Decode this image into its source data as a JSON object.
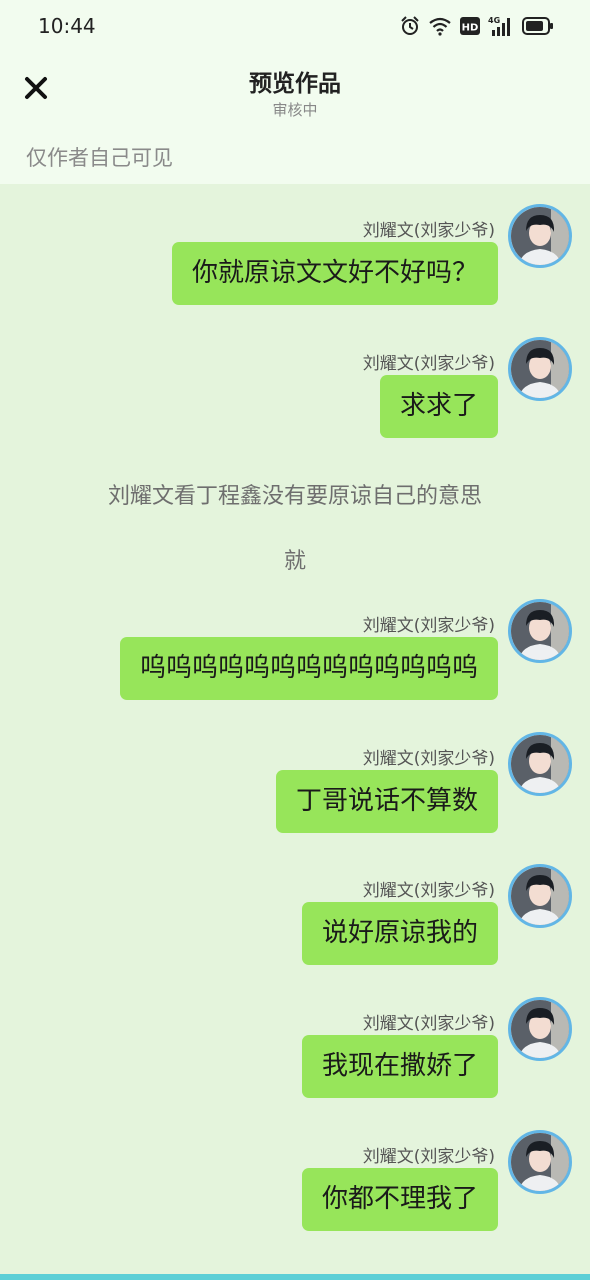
{
  "status_bar": {
    "time": "10:44",
    "icons": [
      "alarm-icon",
      "wifi-icon",
      "hd-icon",
      "signal-4g-icon",
      "battery-icon"
    ],
    "hd_label": "HD",
    "network_label": "4G"
  },
  "nav": {
    "close_icon": "close-icon",
    "title": "预览作品",
    "subtitle": "审核中"
  },
  "visibility_note": "仅作者自己可见",
  "colors": {
    "background": "#e4f4dc",
    "header_background": "#f2fcef",
    "bubble": "#97e55a",
    "avatar_border": "#62b6e6",
    "bottom_strip": "#5ccfd6"
  },
  "chat": [
    {
      "type": "message",
      "sender": "刘耀文(刘家少爷)",
      "text": "你就原谅文文好不好吗？"
    },
    {
      "type": "message",
      "sender": "刘耀文(刘家少爷)",
      "text": "求求了"
    },
    {
      "type": "narration",
      "text": "刘耀文看丁程鑫没有要原谅自己的意思"
    },
    {
      "type": "narration",
      "text": "就"
    },
    {
      "type": "message",
      "sender": "刘耀文(刘家少爷)",
      "text": "呜呜呜呜呜呜呜呜呜呜呜呜呜"
    },
    {
      "type": "message",
      "sender": "刘耀文(刘家少爷)",
      "text": "丁哥说话不算数"
    },
    {
      "type": "message",
      "sender": "刘耀文(刘家少爷)",
      "text": "说好原谅我的"
    },
    {
      "type": "message",
      "sender": "刘耀文(刘家少爷)",
      "text": "我现在撒娇了"
    },
    {
      "type": "message",
      "sender": "刘耀文(刘家少爷)",
      "text": "你都不理我了"
    }
  ]
}
